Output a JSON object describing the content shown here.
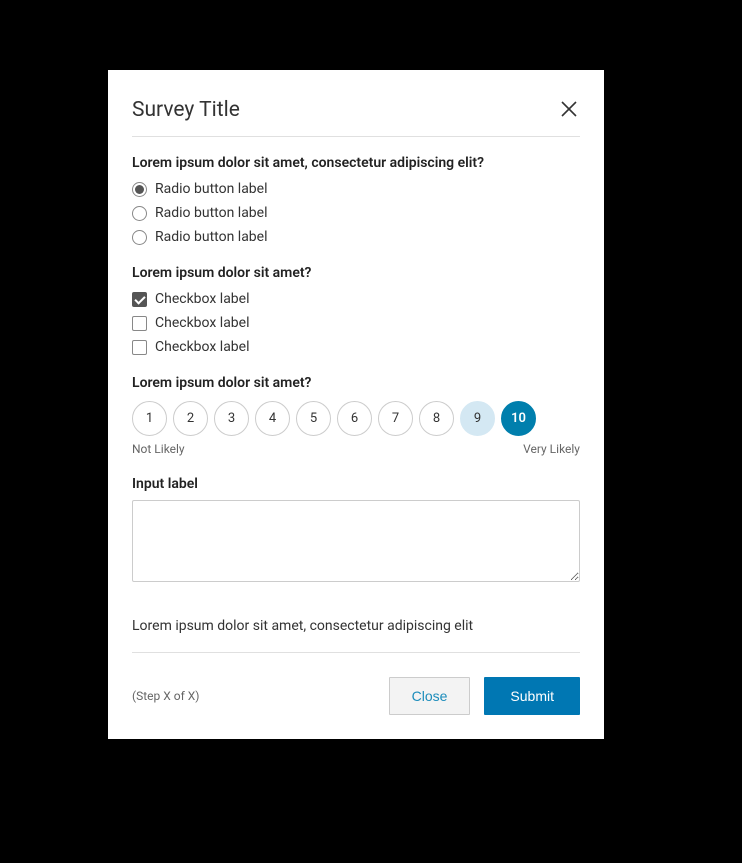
{
  "modal": {
    "title": "Survey Title"
  },
  "q1": {
    "label": "Lorem ipsum dolor sit amet, consectetur adipiscing elit?",
    "options": [
      {
        "label": "Radio button label",
        "checked": true
      },
      {
        "label": "Radio button label",
        "checked": false
      },
      {
        "label": "Radio button label",
        "checked": false
      }
    ]
  },
  "q2": {
    "label": "Lorem ipsum dolor sit amet?",
    "options": [
      {
        "label": "Checkbox label",
        "checked": true
      },
      {
        "label": "Checkbox label",
        "checked": false
      },
      {
        "label": "Checkbox label",
        "checked": false
      }
    ]
  },
  "q3": {
    "label": "Lorem ipsum dolor sit amet?",
    "scale": [
      "1",
      "2",
      "3",
      "4",
      "5",
      "6",
      "7",
      "8",
      "9",
      "10"
    ],
    "hover_index": 8,
    "selected_index": 9,
    "low_label": "Not Likely",
    "high_label": "Very Likely"
  },
  "q4": {
    "label": "Input label",
    "value": ""
  },
  "description": "Lorem ipsum dolor sit amet, consectetur adipiscing elit",
  "footer": {
    "step": "(Step X of X)",
    "close": "Close",
    "submit": "Submit"
  }
}
